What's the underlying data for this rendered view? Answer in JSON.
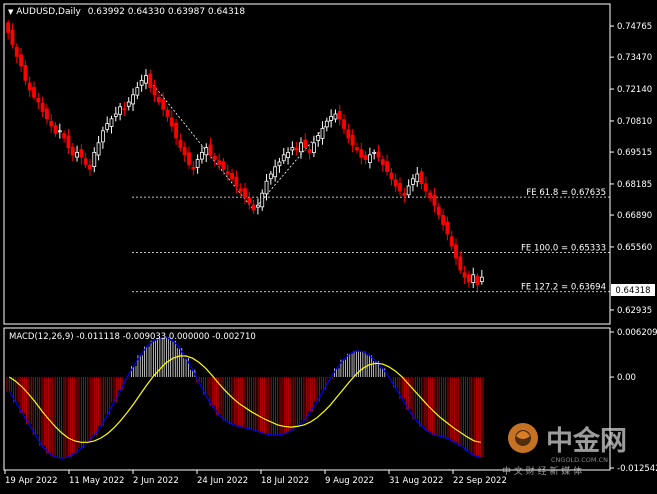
{
  "header": {
    "symbol_label": "AUDUSD,Daily",
    "ohlc_text": "0.63992 0.64330 0.63987 0.64318"
  },
  "price_scale": {
    "ticks": [
      "0.74765",
      "0.73470",
      "0.72140",
      "0.70810",
      "0.69515",
      "0.68185",
      "0.66890",
      "0.65560",
      "0.64318",
      "0.62935"
    ],
    "current_price": "0.64318"
  },
  "fib_levels": [
    {
      "label": "FE 61.8 = 0.67635",
      "value": 0.67635
    },
    {
      "label": "FE 100.0 = 0.65333",
      "value": 0.65333
    },
    {
      "label": "FE 127.2 = 0.63694",
      "value": 0.63694
    }
  ],
  "macd": {
    "label": "MACD(12,26,9) -0.011118 -0.009033 0.000000 -0.002710",
    "ticks": [
      "0.006209",
      "0.00",
      "-0.012542"
    ]
  },
  "time_axis": {
    "labels": [
      "19 Apr 2022",
      "11 May 2022",
      "2 Jun 2022",
      "24 Jun 2022",
      "18 Jul 2022",
      "9 Aug 2022",
      "31 Aug 2022",
      "22 Sep 2022"
    ]
  },
  "watermark": {
    "brand": "中金网",
    "domain": "CNGOLD.COM.CN",
    "slogan": "中 文 财 经 新 媒 体"
  },
  "colors": {
    "background": "#000000",
    "bull_candle": "#ffffff",
    "bear_candle": "#ff0000",
    "macd_main": "#0000ff",
    "macd_signal": "#ffff00",
    "grid": "#ffffff",
    "watermark_orange": "#e8862a"
  },
  "chart_data": {
    "type": "candlestick",
    "symbol": "AUDUSD",
    "timeframe": "Daily",
    "ylim": [
      0.626,
      0.7535
    ],
    "approx_closes": [
      0.745,
      0.74,
      0.735,
      0.731,
      0.725,
      0.721,
      0.718,
      0.716,
      0.712,
      0.709,
      0.706,
      0.703,
      0.704,
      0.701,
      0.697,
      0.694,
      0.695,
      0.693,
      0.69,
      0.688,
      0.695,
      0.699,
      0.704,
      0.707,
      0.709,
      0.711,
      0.714,
      0.713,
      0.716,
      0.719,
      0.722,
      0.725,
      0.727,
      0.722,
      0.719,
      0.716,
      0.713,
      0.71,
      0.706,
      0.701,
      0.697,
      0.694,
      0.69,
      0.688,
      0.692,
      0.695,
      0.697,
      0.694,
      0.692,
      0.69,
      0.688,
      0.686,
      0.684,
      0.681,
      0.679,
      0.676,
      0.674,
      0.671,
      0.673,
      0.678,
      0.683,
      0.686,
      0.689,
      0.691,
      0.694,
      0.695,
      0.697,
      0.696,
      0.699,
      0.697,
      0.695,
      0.699,
      0.702,
      0.705,
      0.708,
      0.71,
      0.711,
      0.709,
      0.705,
      0.701,
      0.698,
      0.696,
      0.693,
      0.692,
      0.694,
      0.695,
      0.693,
      0.69,
      0.687,
      0.684,
      0.681,
      0.679,
      0.677,
      0.681,
      0.684,
      0.686,
      0.682,
      0.679,
      0.676,
      0.673,
      0.669,
      0.665,
      0.661,
      0.656,
      0.651,
      0.646,
      0.643,
      0.641,
      0.644,
      0.64,
      0.643
    ],
    "macd_main": [
      -0.002,
      -0.0035,
      -0.005,
      -0.0065,
      -0.008,
      -0.0095,
      -0.0105,
      -0.011,
      -0.0112,
      -0.011,
      -0.0105,
      -0.0098,
      -0.009,
      -0.008,
      -0.0068,
      -0.0052,
      -0.0035,
      -0.0018,
      0.0,
      0.0015,
      0.003,
      0.0042,
      0.005,
      0.0054,
      0.0055,
      0.005,
      0.004,
      0.0026,
      0.001,
      -0.0008,
      -0.0025,
      -0.004,
      -0.0052,
      -0.006,
      -0.0065,
      -0.0068,
      -0.007,
      -0.0072,
      -0.0075,
      -0.0078,
      -0.008,
      -0.008,
      -0.0078,
      -0.0074,
      -0.0068,
      -0.006,
      -0.0048,
      -0.0034,
      -0.0018,
      -0.0002,
      0.0012,
      0.0024,
      0.0032,
      0.0036,
      0.0035,
      0.003,
      0.0022,
      0.0012,
      0.0,
      -0.0015,
      -0.003,
      -0.0045,
      -0.0058,
      -0.0068,
      -0.0075,
      -0.008,
      -0.0082,
      -0.0085,
      -0.009,
      -0.0095,
      -0.0102,
      -0.0108,
      -0.0111
    ],
    "macd_signal": [
      0.0,
      -0.0006,
      -0.0014,
      -0.0024,
      -0.0035,
      -0.0047,
      -0.0058,
      -0.0068,
      -0.0077,
      -0.0084,
      -0.0088,
      -0.009,
      -0.009,
      -0.0088,
      -0.0084,
      -0.0078,
      -0.007,
      -0.006,
      -0.0049,
      -0.0037,
      -0.0024,
      -0.0011,
      0.0001,
      0.0011,
      0.002,
      0.0026,
      0.0029,
      0.0029,
      0.0026,
      0.002,
      0.0012,
      0.0002,
      -0.0009,
      -0.0019,
      -0.0028,
      -0.0036,
      -0.0042,
      -0.0048,
      -0.0053,
      -0.0058,
      -0.0062,
      -0.0066,
      -0.0068,
      -0.0069,
      -0.0068,
      -0.0066,
      -0.0062,
      -0.0056,
      -0.0048,
      -0.0039,
      -0.0028,
      -0.0017,
      -0.0006,
      0.0004,
      0.0012,
      0.0017,
      0.0019,
      0.0018,
      0.0014,
      0.0008,
      0.0,
      -0.001,
      -0.002,
      -0.003,
      -0.004,
      -0.0049,
      -0.0057,
      -0.0064,
      -0.0071,
      -0.0077,
      -0.0083,
      -0.0088,
      -0.009
    ]
  }
}
